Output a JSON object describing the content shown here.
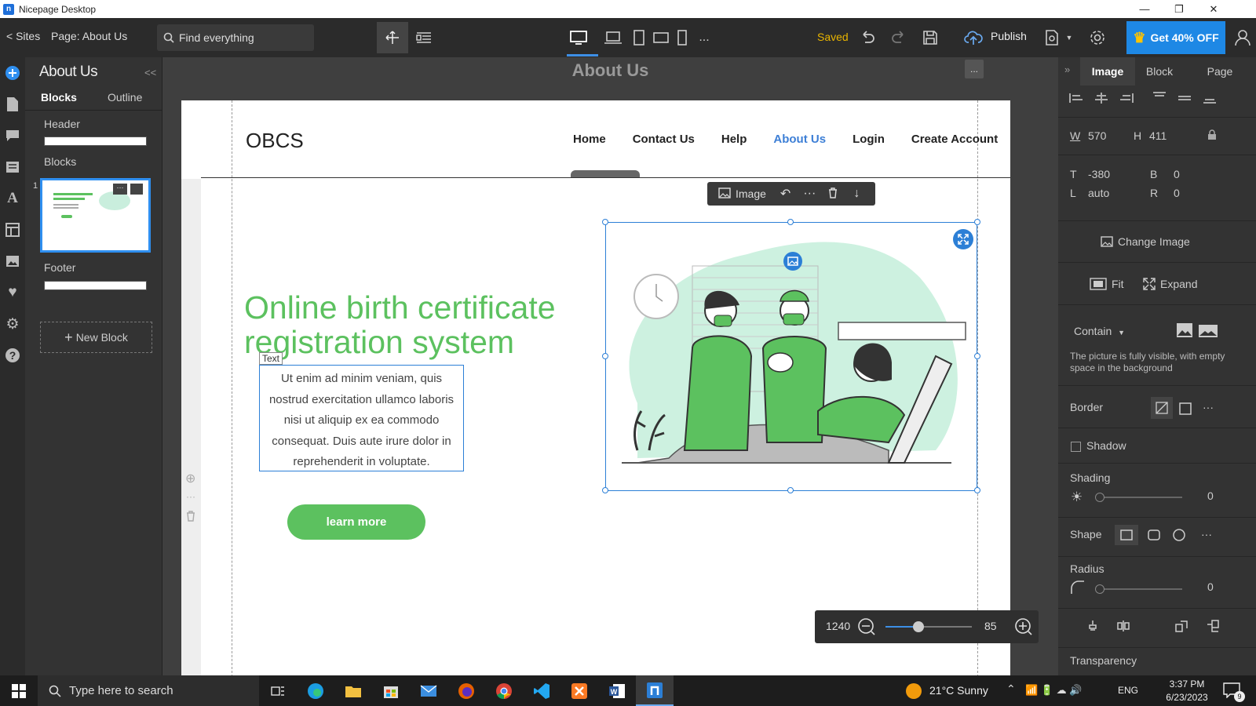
{
  "window": {
    "app_name": "Nicepage Desktop",
    "logo": "n",
    "minimize": "—",
    "maximize": "❐",
    "close": "✕"
  },
  "toolbar": {
    "sites": "< Sites",
    "page_label": "Page: About Us",
    "search_placeholder": "Find everything",
    "saved": "Saved",
    "publish": "Publish",
    "promo": "Get 40% OFF",
    "more": "..."
  },
  "left_panel": {
    "title": "About Us",
    "collapse": "<<",
    "tabs": [
      "Blocks",
      "Outline"
    ],
    "header_label": "Header",
    "blocks_label": "Blocks",
    "block_index": "1",
    "footer_label": "Footer",
    "new_block": "New Block"
  },
  "canvas": {
    "page_title": "About Us",
    "more": "...",
    "site": {
      "logo": "OBCS",
      "nav": [
        "Home",
        "Contact Us",
        "Help",
        "About Us",
        "Login",
        "Create Account"
      ],
      "nav_active_index": 3,
      "heading": "Online birth certificate registration system",
      "text_tag": "Text",
      "body_text": "Ut enim ad minim veniam, quis nostrud exercitation ullamco laboris nisi ut aliquip ex ea commodo consequat. Duis aute irure dolor in reprehenderit in voluptate.",
      "button": "learn more"
    },
    "image_toolbar": {
      "label": "Image"
    },
    "zoom": {
      "width": "1240",
      "value": "85",
      "slider_fraction": 0.38
    }
  },
  "right_panel": {
    "tabs": [
      "Image",
      "Block",
      "Page"
    ],
    "active_tab": "Image",
    "w_label": "W",
    "w_value": "570",
    "h_label": "H",
    "h_value": "411",
    "t_label": "T",
    "t_value": "-380",
    "b_label": "B",
    "b_value": "0",
    "l_label": "L",
    "l_value": "auto",
    "r_label": "R",
    "r_value": "0",
    "change_image": "Change Image",
    "fit": "Fit",
    "expand": "Expand",
    "contain": "Contain",
    "contain_desc": "The picture is fully visible, with empty space in the background",
    "border": "Border",
    "shadow": "Shadow",
    "shading": "Shading",
    "shading_value": "0",
    "shape": "Shape",
    "radius": "Radius",
    "radius_value": "0",
    "transparency": "Transparency"
  },
  "taskbar": {
    "search_placeholder": "Type here to search",
    "weather": "21°C  Sunny",
    "lang": "ENG",
    "time": "3:37 PM",
    "date": "6/23/2023",
    "notif_count": "9"
  },
  "colors": {
    "accent_green": "#5cc15f",
    "nav_active": "#3d7fd6",
    "promo_blue": "#1e88e5",
    "selection": "#2c7fd6"
  }
}
